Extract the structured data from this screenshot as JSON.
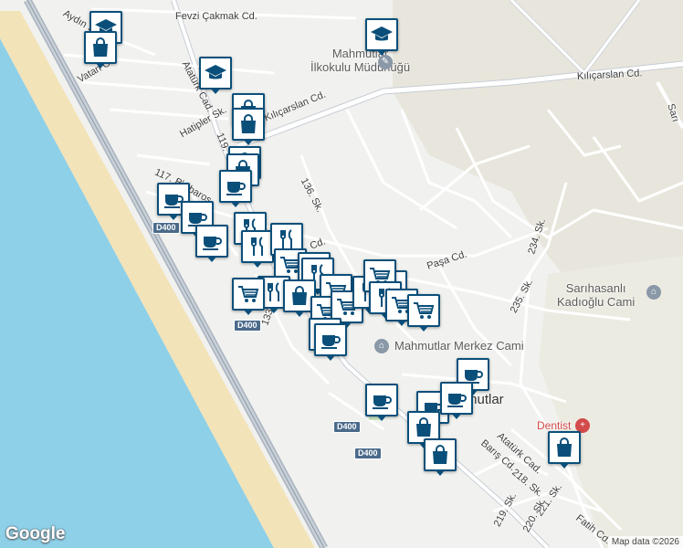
{
  "map": {
    "attribution": "Map data ©2026",
    "provider_logo": "Google",
    "colors": {
      "land": "#f1f2ef",
      "sea": "#8ed0e8",
      "beach": "#f3e3b8",
      "road_major": "#b9c2cd",
      "road_minor": "#ffffff",
      "pin_border": "#0a4f7a",
      "pin_icon": "#0a4f7a",
      "dentist": "#d24a4a"
    }
  },
  "street_labels": [
    {
      "text": "Fevzi Çakmak Cd."
    },
    {
      "text": "Aydın S"
    },
    {
      "text": "Vatan Cd."
    },
    {
      "text": "Atatürk Cad."
    },
    {
      "text": "Hatipler Sk."
    },
    {
      "text": "119."
    },
    {
      "text": "117. Sk."
    },
    {
      "text": "Barbaros"
    },
    {
      "text": "Kılıçarslan Cd."
    },
    {
      "text": "Kılıçarslan Cd."
    },
    {
      "text": "136. Sk."
    },
    {
      "text": "Cd."
    },
    {
      "text": "Paşa Cd."
    },
    {
      "text": "234. Sk."
    },
    {
      "text": "235. Sk."
    },
    {
      "text": "133."
    },
    {
      "text": "Atatürk Cad."
    },
    {
      "text": "Barış Cd."
    },
    {
      "text": "218. Sk."
    },
    {
      "text": "221. Sk."
    },
    {
      "text": "219. Sk."
    },
    {
      "text": "220. Sk."
    },
    {
      "text": "Fatih Cd."
    },
    {
      "text": "Sarı"
    }
  ],
  "road_shields": [
    {
      "text": "D400"
    },
    {
      "text": "D400"
    },
    {
      "text": "D400"
    },
    {
      "text": "D400"
    }
  ],
  "places": [
    {
      "text": "Mahmutlar",
      "line2": "İlkokulu Müdürlüğü",
      "icon": "school-icon"
    },
    {
      "text": "Sarıhasanlı",
      "line2": "Kadıoğlu Cami",
      "icon": "mosque-icon"
    },
    {
      "text": "Mahmutlar Merkez Cami",
      "line2": "",
      "icon": "mosque-icon"
    },
    {
      "text": "Dentist",
      "line2": "",
      "icon": "medical-icon"
    },
    {
      "text": "mutlar",
      "line2": "",
      "icon": ""
    }
  ],
  "markers": [
    {
      "type": "school"
    },
    {
      "type": "shopping"
    },
    {
      "type": "school"
    },
    {
      "type": "school"
    },
    {
      "type": "shopping"
    },
    {
      "type": "shopping"
    },
    {
      "type": "shopping"
    },
    {
      "type": "shopping"
    },
    {
      "type": "cafe"
    },
    {
      "type": "cafe"
    },
    {
      "type": "cafe"
    },
    {
      "type": "restaurant"
    },
    {
      "type": "cafe"
    },
    {
      "type": "restaurant"
    },
    {
      "type": "restaurant"
    },
    {
      "type": "grocery"
    },
    {
      "type": "grocery"
    },
    {
      "type": "restaurant"
    },
    {
      "type": "grocery"
    },
    {
      "type": "restaurant"
    },
    {
      "type": "shopping"
    },
    {
      "type": "grocery"
    },
    {
      "type": "grocery"
    },
    {
      "type": "grocery"
    },
    {
      "type": "restaurant"
    },
    {
      "type": "grocery"
    },
    {
      "type": "grocery"
    },
    {
      "type": "restaurant"
    },
    {
      "type": "grocery"
    },
    {
      "type": "grocery"
    },
    {
      "type": "cafe"
    },
    {
      "type": "cafe"
    },
    {
      "type": "cafe"
    },
    {
      "type": "cafe"
    },
    {
      "type": "cafe"
    },
    {
      "type": "cafe"
    },
    {
      "type": "shopping"
    },
    {
      "type": "shopping"
    },
    {
      "type": "shopping"
    }
  ]
}
